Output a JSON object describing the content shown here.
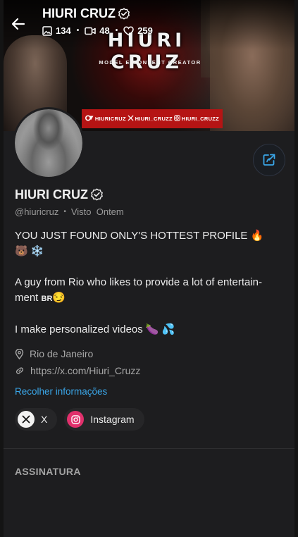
{
  "header": {
    "name": "HIURI CRUZ",
    "stats": [
      {
        "icon": "image-icon",
        "value": "134"
      },
      {
        "icon": "video-icon",
        "value": "48"
      },
      {
        "icon": "heart-icon",
        "value": "259"
      }
    ]
  },
  "banner": {
    "title": "HIURI CRUZ",
    "subtitle": "MODEL E CONTENT CREATOR",
    "socials": [
      {
        "icon": "onlyfans-icon",
        "label": "HIURICRUZ"
      },
      {
        "icon": "x-icon",
        "label": "HIURI_CRUZZ"
      },
      {
        "icon": "instagram-icon",
        "label": "HIURI_CRUZZ"
      }
    ]
  },
  "profile": {
    "name": "HIURI CRUZ",
    "handle": "@hiuricruz",
    "separator": "•",
    "last_seen": "Visto  Ontem",
    "bio_line1": "YOU JUST FOUND ONLY'S HOTTEST PROFILE 🔥",
    "bio_line2": "🐻 ❄️",
    "bio_line3": "A guy from Rio who likes to provide a lot of entertain-",
    "bio_line4_text": "ment ",
    "bio_line4_flag": "BR",
    "bio_line4_emoji": "😏",
    "bio_line5": "I make personalized videos 🍆 💦",
    "location": "Rio de Janeiro",
    "link": "https://x.com/Hiuri_Cruzz",
    "collapse_label": "Recolher informações"
  },
  "social_chips": [
    {
      "icon": "x-icon",
      "label": "X"
    },
    {
      "icon": "instagram-icon",
      "label": "Instagram"
    }
  ],
  "sections": {
    "subscription_title": "ASSINATURA"
  },
  "colors": {
    "background": "#1d1d1f",
    "accent_link": "#3aa6e8",
    "share_icon": "#3aa6e8",
    "banner_red": "#b51414",
    "instagram": "#e1306c"
  }
}
